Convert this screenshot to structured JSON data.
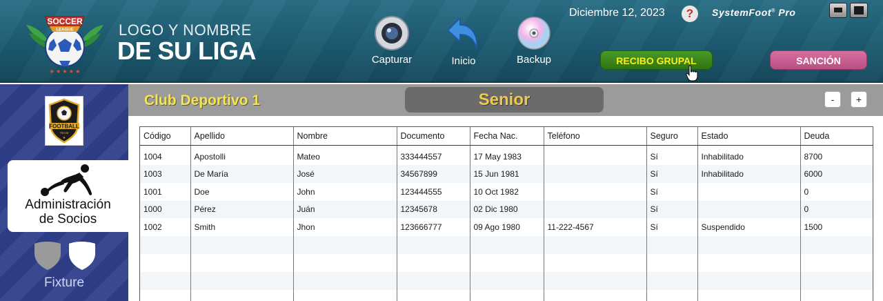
{
  "header": {
    "logo_text_top": "SOCCER",
    "logo_text_bottom": "LEAGUE",
    "league_line1": "LOGO Y NOMBRE",
    "league_line2": "DE SU LIGA",
    "tools": [
      {
        "label": "Capturar",
        "icon": "camera-icon"
      },
      {
        "label": "Inicio",
        "icon": "back-arrow-icon"
      },
      {
        "label": "Backup",
        "icon": "disc-icon"
      }
    ],
    "date": "Diciembre 12, 2023",
    "help_symbol": "?",
    "brand": "SystemFoot",
    "brand_reg": "®",
    "brand_suffix": " Pro",
    "btn_recibo": "RECIBO GRUPAL",
    "btn_sancion": "SANCIÓN"
  },
  "sidebar": {
    "club_badge_text": "FOOTBALL",
    "club_badge_sub": "TEAM",
    "active_label_line1": "Administración",
    "active_label_line2": "de Socios",
    "fixture_label": "Fixture"
  },
  "main": {
    "club_name": "Club Deportivo 1",
    "category": "Senior",
    "zoom_minus": "-",
    "zoom_plus": "+"
  },
  "table": {
    "columns": [
      "Código",
      "Apellido",
      "Nombre",
      "Documento",
      "Fecha Nac.",
      "Teléfono",
      "Seguro",
      "Estado",
      "Deuda"
    ],
    "rows": [
      [
        "1004",
        "Apostolli",
        "Mateo",
        "333444557",
        "17 May 1983",
        "",
        "Sí",
        "Inhabilitado",
        "8700"
      ],
      [
        "1003",
        "De María",
        "José",
        "34567899",
        "15 Jun 1981",
        "",
        "Sí",
        "Inhabilitado",
        "6000"
      ],
      [
        "1001",
        "Doe",
        "John",
        "123444555",
        "10 Oct 1982",
        "",
        "Sí",
        "",
        "0"
      ],
      [
        "1000",
        "Pérez",
        "Juán",
        "12345678",
        "02 Dic 1980",
        "",
        "Sí",
        "",
        "0"
      ],
      [
        "1002",
        "Smith",
        "Jhon",
        "123666777",
        "09 Ago 1980",
        "11-222-4567",
        "Sí",
        "Suspendido",
        "1500"
      ]
    ]
  },
  "colors": {
    "header_bg": "#1d5a70",
    "sidebar_bg": "#303e8c",
    "recibo_bg": "#3f8a1e",
    "recibo_text": "#f6f020",
    "sancion_bg": "#c85a8e",
    "club_name": "#f5e35a",
    "category_text": "#f0c94a"
  }
}
